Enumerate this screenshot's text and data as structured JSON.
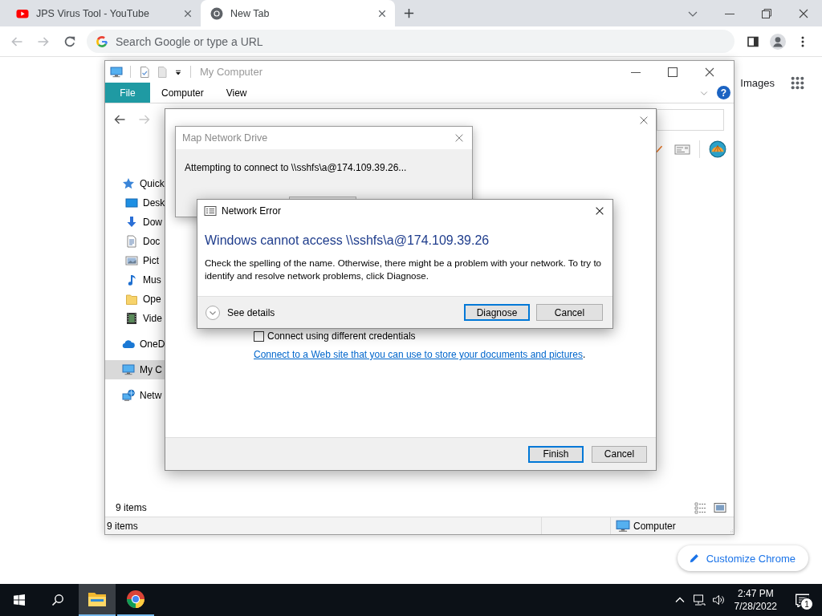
{
  "browser": {
    "tabs": [
      {
        "kind": "video-site",
        "title": "JPS Virus Tool - YouTube",
        "selected": false
      },
      {
        "kind": "new-tab",
        "title": "New Tab",
        "selected": true
      }
    ],
    "nav_buttons": [
      {
        "kind": "back",
        "disabled": true
      },
      {
        "kind": "forward",
        "disabled": true
      },
      {
        "kind": "reload",
        "disabled": false
      }
    ],
    "omnibox": {
      "placeholder": "Search Google or type a URL"
    },
    "page": {
      "link": "Images",
      "customize_button": "Customize Chrome"
    }
  },
  "explorer": {
    "title": "My Computer",
    "help": "?",
    "ribbon_tabs": [
      {
        "kind": "file",
        "label": "File"
      },
      {
        "kind": "tab",
        "label": "Computer"
      },
      {
        "kind": "tab",
        "label": "View"
      }
    ],
    "nav_buttons": [
      {
        "kind": "back",
        "disabled": false
      },
      {
        "kind": "forward",
        "disabled": true
      }
    ],
    "nav_items": [
      {
        "kind": "star",
        "label": "Quick",
        "selected": false,
        "children": [
          {
            "kind": "desktop",
            "label": "Desk",
            "selected": false
          },
          {
            "kind": "download",
            "label": "Dow",
            "selected": false
          },
          {
            "kind": "document",
            "label": "Doc",
            "selected": false
          },
          {
            "kind": "pictures",
            "label": "Pict",
            "selected": false
          },
          {
            "kind": "music",
            "label": "Mus",
            "selected": false
          },
          {
            "kind": "folder",
            "label": "Ope",
            "selected": false
          },
          {
            "kind": "video",
            "label": "Vide",
            "selected": false
          }
        ]
      },
      {
        "kind": "cloud",
        "label": "OneD",
        "selected": false
      },
      {
        "kind": "computer",
        "label": "My C",
        "selected": true
      },
      {
        "kind": "network",
        "label": "Netw",
        "selected": false
      }
    ],
    "item_count": "9 items",
    "status_bar": {
      "items": "9 items",
      "location": "Computer"
    }
  },
  "wizard": {
    "checkbox": {
      "label": "Connect using different credentials",
      "checked": false
    },
    "link": "Connect to a Web site that you can use to store your documents and pictures",
    "link_suffix": ".",
    "buttons": [
      {
        "label": "Finish",
        "default": true
      },
      {
        "label": "Cancel",
        "default": false
      }
    ]
  },
  "progress_dialog": {
    "title": "Map Network Drive",
    "message": "Attempting to connect to \\\\sshfs\\a@174.109.39.26..."
  },
  "error_dialog": {
    "title": "Network Error",
    "heading": "Windows cannot access \\\\sshfs\\a@174.109.39.26",
    "message": "Check the spelling of the name. Otherwise, there might be a problem with your network. To try to identify and resolve network problems, click Diagnose.",
    "details": "See details",
    "buttons": [
      {
        "label": "Diagnose",
        "default": true
      },
      {
        "label": "Cancel",
        "default": false
      }
    ]
  },
  "taskbar": {
    "apps": [
      {
        "kind": "explorer",
        "active": true
      },
      {
        "kind": "browser",
        "active": false
      }
    ],
    "time": "2:47 PM",
    "date": "7/28/2022",
    "notifications": "1"
  }
}
